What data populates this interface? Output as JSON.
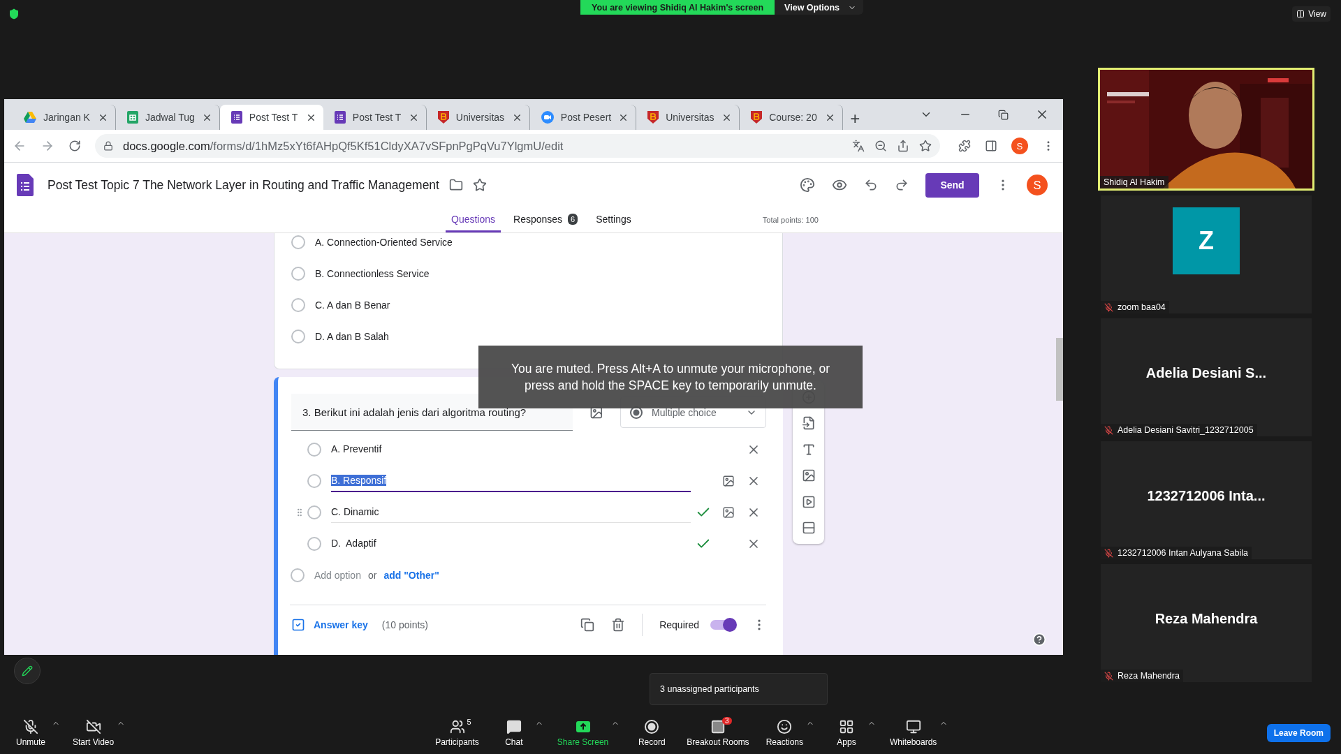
{
  "zoom_banner": {
    "viewing": "You are viewing Shidiq Al Hakim's screen",
    "view_options": "View Options"
  },
  "view_button": "View",
  "browser": {
    "tabs": [
      {
        "title": "Jaringan K",
        "kind": "drive",
        "selected": false
      },
      {
        "title": "Jadwal Tug",
        "kind": "sheets",
        "selected": false
      },
      {
        "title": "Post Test T",
        "kind": "forms",
        "selected": true
      },
      {
        "title": "Post Test T",
        "kind": "forms",
        "selected": false
      },
      {
        "title": "Universitas",
        "kind": "campus",
        "selected": false
      },
      {
        "title": "Post Pesert",
        "kind": "zoom",
        "selected": false
      },
      {
        "title": "Universitas",
        "kind": "campus",
        "selected": false
      },
      {
        "title": "Course: 20",
        "kind": "campus",
        "selected": false
      }
    ],
    "new_tab": "+",
    "url_host": "docs.google.com",
    "url_path": "/forms/d/1hMz5xYt6fAHpQf5Kf51CldyXA7vSFpnPgPqVu7YlgmU/edit",
    "profile": "S"
  },
  "form": {
    "title": "Post Test Topic 7 The Network Layer in Routing and Traffic Management",
    "send": "Send",
    "avatar": "S",
    "tabs": [
      {
        "label": "Questions",
        "selected": true
      },
      {
        "label": "Responses",
        "badge": "6",
        "selected": false
      },
      {
        "label": "Settings",
        "selected": false
      }
    ],
    "total_points": "Total points: 100",
    "previous_options": [
      {
        "label": "A. Connection-Oriented Service",
        "selected": false
      },
      {
        "label": "B. Connectionless Service",
        "selected": false
      },
      {
        "label": "C. A dan B Benar",
        "selected": false
      },
      {
        "label": "D. A dan B Salah",
        "selected": false
      }
    ],
    "question": {
      "text": "3. Berikut ini adalah jenis dari algoritma routing?",
      "type": "Multiple choice",
      "options": [
        {
          "label": "A. Preventif",
          "selected": false,
          "correct": false,
          "editing": false,
          "hovered": false
        },
        {
          "label": "B. Responsif",
          "selected": false,
          "correct": false,
          "editing": true,
          "hovered": false
        },
        {
          "label": "C. Dinamic",
          "selected": false,
          "correct": true,
          "editing": false,
          "hovered": true
        },
        {
          "label": "D.  Adaptif",
          "selected": false,
          "correct": true,
          "editing": false,
          "hovered": false
        }
      ],
      "add_option": "Add option",
      "or": "or",
      "add_other": "add \"Other\"",
      "answer_key": "Answer key",
      "points": "(10 points)",
      "required_label": "Required",
      "required": true
    }
  },
  "toast": "You are muted. Press Alt+A to unmute your microphone, or press and hold the SPACE key to temporarily unmute.",
  "tooltip": "3 unassigned participants",
  "participants": [
    {
      "kind": "video",
      "name": "Shidiq Al Hakim",
      "muted": false
    },
    {
      "kind": "avatar",
      "avatar": "Z",
      "color": "#0097a7",
      "name": "zoom baa04",
      "muted": true
    },
    {
      "kind": "name",
      "display": "Adelia Desiani S...",
      "name": "Adelia Desiani Savitri_1232712005",
      "muted": true
    },
    {
      "kind": "name",
      "display": "1232712006 Inta...",
      "name": "1232712006 Intan Aulyana Sabila",
      "muted": true
    },
    {
      "kind": "name",
      "display": "Reza Mahendra",
      "name": "Reza Mahendra",
      "muted": true
    }
  ],
  "toolbar": {
    "left": [
      {
        "label": "Unmute",
        "kind": "mic-off",
        "caret": true
      },
      {
        "label": "Start Video",
        "kind": "video-off",
        "caret": true
      }
    ],
    "center": [
      {
        "label": "Participants",
        "kind": "participants",
        "count": "5",
        "caret": false
      },
      {
        "label": "Chat",
        "kind": "chat",
        "caret": true
      },
      {
        "label": "Share Screen",
        "kind": "share",
        "caret": true
      },
      {
        "label": "Record",
        "kind": "record",
        "caret": false
      },
      {
        "label": "Breakout Rooms",
        "kind": "breakout",
        "badge": "3",
        "caret": false
      },
      {
        "label": "Reactions",
        "kind": "reactions",
        "caret": true
      },
      {
        "label": "Apps",
        "kind": "apps",
        "caret": true
      },
      {
        "label": "Whiteboards",
        "kind": "whiteboards",
        "caret": true
      }
    ],
    "leave": "Leave Room"
  }
}
